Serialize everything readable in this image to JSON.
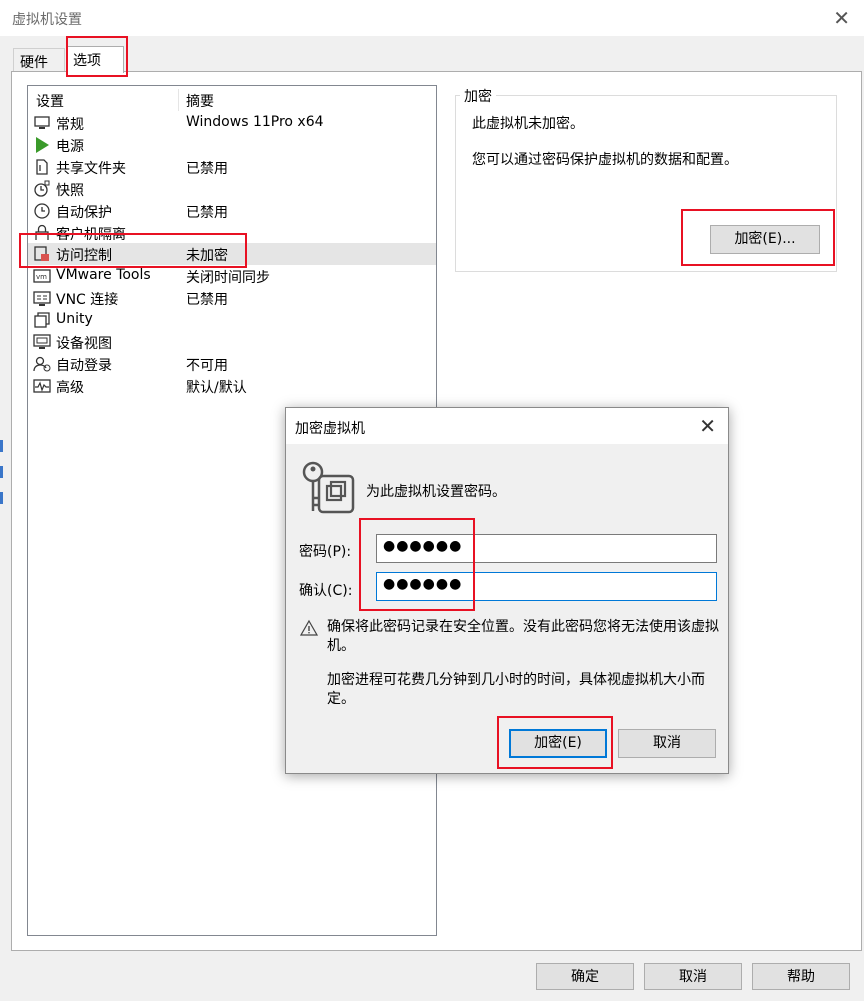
{
  "window": {
    "title": "虚拟机设置",
    "close_glyph": "✕"
  },
  "tabs": [
    {
      "label": "硬件"
    },
    {
      "label": "选项"
    }
  ],
  "list": {
    "headers": {
      "setting": "设置",
      "summary": "摘要"
    },
    "items": [
      {
        "label": "常规",
        "summary": "Windows 11Pro x64",
        "icon": "monitor-icon"
      },
      {
        "label": "电源",
        "summary": "",
        "icon": "play-icon"
      },
      {
        "label": "共享文件夹",
        "summary": "已禁用",
        "icon": "shared-folder-icon"
      },
      {
        "label": "快照",
        "summary": "",
        "icon": "snapshot-icon"
      },
      {
        "label": "自动保护",
        "summary": "已禁用",
        "icon": "clock-icon"
      },
      {
        "label": "客户机隔离",
        "summary": "",
        "icon": "lock-icon"
      },
      {
        "label": "访问控制",
        "summary": "未加密",
        "icon": "access-control-icon"
      },
      {
        "label": "VMware Tools",
        "summary": "关闭时间同步",
        "icon": "vmware-tools-icon"
      },
      {
        "label": "VNC 连接",
        "summary": "已禁用",
        "icon": "vnc-icon"
      },
      {
        "label": "Unity",
        "summary": "",
        "icon": "unity-icon"
      },
      {
        "label": "设备视图",
        "summary": "",
        "icon": "device-view-icon"
      },
      {
        "label": "自动登录",
        "summary": "不可用",
        "icon": "autologin-icon"
      },
      {
        "label": "高级",
        "summary": "默认/默认",
        "icon": "advanced-icon"
      }
    ],
    "selected_index": 6
  },
  "encryption": {
    "group_title": "加密",
    "status_text": "此虚拟机未加密。",
    "description": "您可以通过密码保护虚拟机的数据和配置。",
    "button_label": "加密(E)..."
  },
  "dialog": {
    "title": "加密虚拟机",
    "close_glyph": "✕",
    "intro": "为此虚拟机设置密码。",
    "password_label": "密码(P):",
    "password_value": "●●●●●●",
    "confirm_label": "确认(C):",
    "confirm_value": "●●●●●●",
    "warning": "确保将此密码记录在安全位置。没有此密码您将无法使用该虚拟机。",
    "note": "加密进程可花费几分钟到几小时的时间，具体视虚拟机大小而定。",
    "encrypt_button": "加密(E)",
    "cancel_button": "取消"
  },
  "footer": {
    "ok": "确定",
    "cancel": "取消",
    "help": "帮助"
  },
  "colors": {
    "highlight_box": "#e81123",
    "focus_border": "#0078d7",
    "power_icon": "#3a9a2a"
  }
}
